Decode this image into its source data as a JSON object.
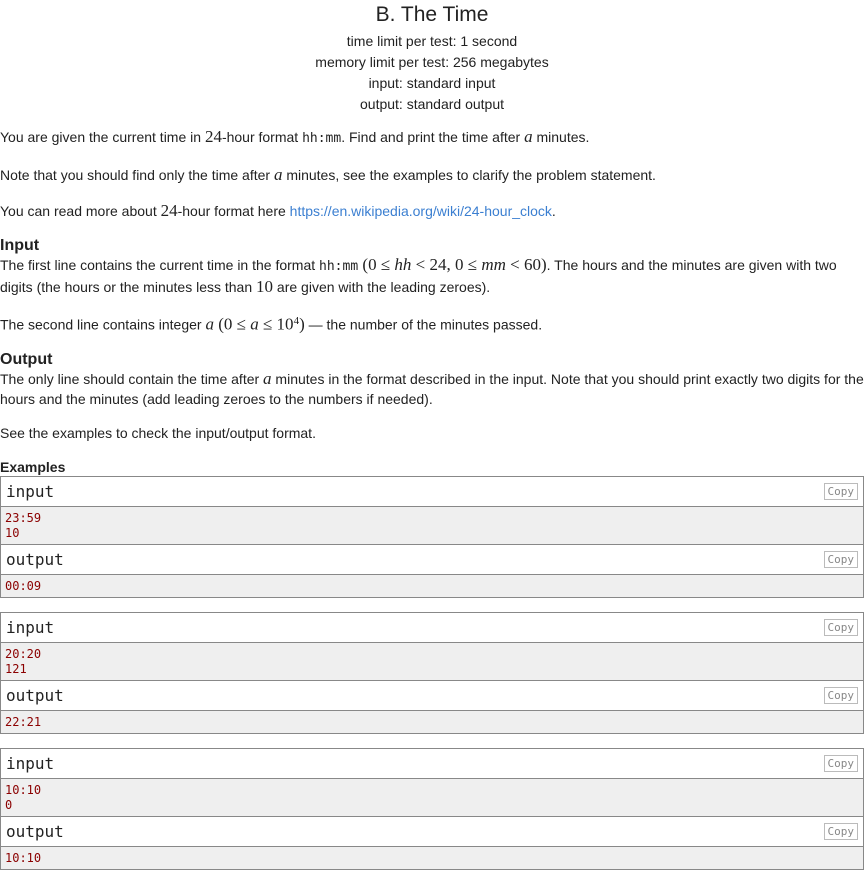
{
  "title": "B. The Time",
  "header": [
    "time limit per test: 1 second",
    "memory limit per test: 256 megabytes",
    "input: standard input",
    "output: standard output"
  ],
  "p1": {
    "a": "You are given the current time in ",
    "n24": "24",
    "b": "-hour format ",
    "code": "hh:mm",
    "c": ". Find and print the time after ",
    "var": "a",
    "d": " minutes."
  },
  "p2": {
    "a": "Note that you should find only the time after ",
    "var": "a",
    "b": " minutes, see the examples to clarify the problem statement."
  },
  "p3": {
    "a": "You can read more about ",
    "n24": "24",
    "b": "-hour format here ",
    "link": "https://en.wikipedia.org/wiki/24-hour_clock",
    "c": "."
  },
  "input_title": "Input",
  "in1": {
    "a": "The first line contains the current time in the format ",
    "code": "hh:mm",
    "math1": " (0 ≤ ",
    "hh": "hh",
    "math2": " < 24, 0 ≤ ",
    "mm": "mm",
    "math3": " < 60)",
    "b": ". The hours and the minutes are given with two digits (the hours or the minutes less than ",
    "n10": "10",
    "c": " are given with the leading zeroes)."
  },
  "in2": {
    "a": "The second line contains integer ",
    "var": "a",
    "m1": " (0 ≤ ",
    "var2": "a",
    "m2": " ≤ 10",
    "sup": "4",
    "m3": ")",
    "b": " — the number of the minutes passed."
  },
  "output_title": "Output",
  "out1": {
    "a": "The only line should contain the time after ",
    "var": "a",
    "b": " minutes in the format described in the input. Note that you should print exactly two digits for the hours and the minutes (add leading zeroes to the numbers if needed)."
  },
  "out2": "See the examples to check the input/output format.",
  "examples_title": "Examples",
  "input_label": "input",
  "output_label": "output",
  "copy_label": "Copy",
  "examples": [
    {
      "input": "23:59\n10",
      "output": "00:09"
    },
    {
      "input": "20:20\n121",
      "output": "22:21"
    },
    {
      "input": "10:10\n0",
      "output": "10:10"
    }
  ]
}
